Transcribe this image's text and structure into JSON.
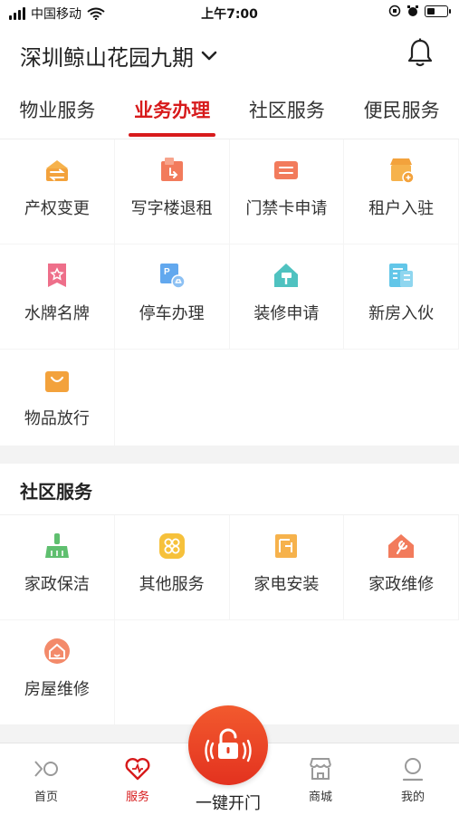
{
  "status_bar": {
    "carrier": "中国移动",
    "time": "上午7:00"
  },
  "header": {
    "community": "深圳鲸山花园九期"
  },
  "tabs": [
    {
      "label": "物业服务",
      "active": false
    },
    {
      "label": "业务办理",
      "active": true
    },
    {
      "label": "社区服务",
      "active": false
    },
    {
      "label": "便民服务",
      "active": false
    }
  ],
  "business": {
    "items": [
      {
        "label": "产权变更",
        "icon": "transfer-icon"
      },
      {
        "label": "写字楼退租",
        "icon": "office-return-icon"
      },
      {
        "label": "门禁卡申请",
        "icon": "access-card-icon"
      },
      {
        "label": "租户入驻",
        "icon": "tenant-shop-icon"
      },
      {
        "label": "水牌名牌",
        "icon": "nameplate-icon"
      },
      {
        "label": "停车办理",
        "icon": "parking-icon"
      },
      {
        "label": "装修申请",
        "icon": "renovation-icon"
      },
      {
        "label": "新房入伙",
        "icon": "new-house-icon"
      },
      {
        "label": "物品放行",
        "icon": "shopping-bag-icon"
      }
    ]
  },
  "community_service": {
    "title": "社区服务",
    "items": [
      {
        "label": "家政保洁",
        "icon": "cleaning-icon"
      },
      {
        "label": "其他服务",
        "icon": "other-services-icon"
      },
      {
        "label": "家电安装",
        "icon": "appliance-install-icon"
      },
      {
        "label": "家政维修",
        "icon": "repair-icon"
      },
      {
        "label": "房屋维修",
        "icon": "house-repair-icon"
      }
    ]
  },
  "bottom_nav": {
    "items": [
      {
        "label": "首页",
        "icon": "home-icon",
        "active": false
      },
      {
        "label": "服务",
        "icon": "heart-service-icon",
        "active": true
      },
      {
        "label": "商城",
        "icon": "store-icon",
        "active": false
      },
      {
        "label": "我的",
        "icon": "profile-icon",
        "active": false
      }
    ],
    "unlock_label": "一键开门"
  },
  "colors": {
    "accent": "#d71a1b",
    "orange": "#f3a23c",
    "coral": "#f27b5c",
    "pink": "#ee6f8a",
    "blue": "#62a8ee",
    "teal": "#4fc2c0",
    "green": "#5fbf6f"
  }
}
